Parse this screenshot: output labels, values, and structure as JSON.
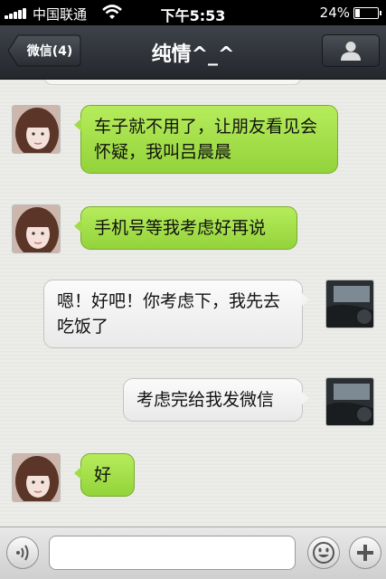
{
  "status_bar": {
    "carrier": "中国联通",
    "time": "下午5:53",
    "battery": "24%",
    "battery_level": 0.24
  },
  "nav": {
    "back_label": "微信(4)",
    "title": "纯情^_^"
  },
  "messages": [
    {
      "side": "left",
      "text": "车子就不用了，让朋友看见会怀疑，我叫吕晨晨"
    },
    {
      "side": "left",
      "text": "手机号等我考虑好再说"
    },
    {
      "side": "right",
      "text": "嗯！好吧！你考虑下，我先去吃饭了"
    },
    {
      "side": "right",
      "text": "考虑完给我发微信"
    },
    {
      "side": "left",
      "text": "好"
    }
  ],
  "input_bar": {
    "value": "",
    "placeholder": ""
  },
  "icons": {
    "voice": "voice-icon",
    "emoji": "emoji-icon",
    "add": "plus-icon",
    "profile": "person-icon"
  },
  "colors": {
    "green_bubble": "#a8e34e",
    "white_bubble": "#f4f4f4",
    "nav_bg": "#2f3338"
  }
}
